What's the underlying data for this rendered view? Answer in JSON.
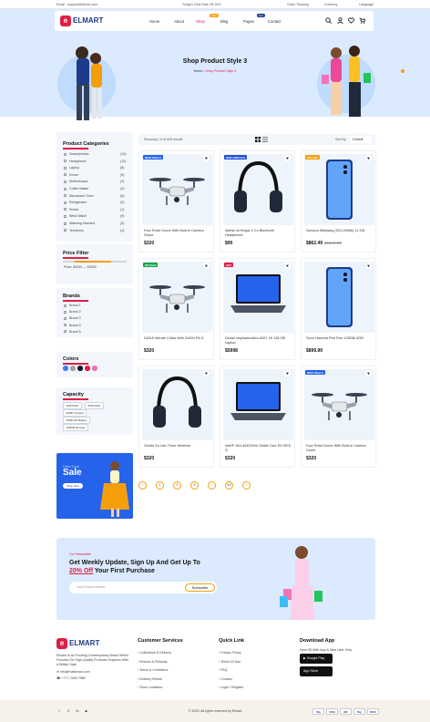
{
  "topbar": {
    "email": "Email : support@elmart.com",
    "deal": "Today's Deal Sale Off 25%",
    "tracking": "Order Tracking",
    "currency": "Currency",
    "language": "Language"
  },
  "brand": {
    "name": "ELMART",
    "letter": "e"
  },
  "nav": {
    "items": [
      "Home",
      "About",
      "Shop",
      "Blog",
      "Pages",
      "Contact"
    ],
    "shop_badge": "Sale",
    "pages_badge": "Hot"
  },
  "hero": {
    "title": "Shop Product Style 3",
    "crumb_home": "Home",
    "crumb_current": "Shop Product Style 3"
  },
  "sidebar": {
    "categories_title": "Product Categories",
    "categories": [
      {
        "name": "Smartphones",
        "count": "(10)"
      },
      {
        "name": "Headphone",
        "count": "(12)"
      },
      {
        "name": "Laptop",
        "count": "(8)"
      },
      {
        "name": "Drone",
        "count": "(5)"
      },
      {
        "name": "Motherboard",
        "count": "(3)"
      },
      {
        "name": "Coffee Maker",
        "count": "(4)"
      },
      {
        "name": "Microwave Oven",
        "count": "(6)"
      },
      {
        "name": "Refrigerator",
        "count": "(2)"
      },
      {
        "name": "Printer",
        "count": "(1)"
      },
      {
        "name": "Wrist Watch",
        "count": "(9)"
      },
      {
        "name": "Washing Machine",
        "count": "(3)"
      },
      {
        "name": "Television",
        "count": "(4)"
      }
    ],
    "price_title": "Price Filter",
    "price_label": "Price:",
    "price_range": "$1000 — $4000",
    "brands_title": "Brands",
    "brands": [
      "Brand 1",
      "Brand 2",
      "Brand 3",
      "Brand 4",
      "Brand 5"
    ],
    "colors_title": "Colors",
    "colors": [
      "#3b82f6",
      "#9ca3af",
      "#111827",
      "#e11d48",
      "#f472b6"
    ],
    "capacity_title": "Capacity",
    "capacity": [
      "4GB RAM",
      "6GB RAM",
      "32MP Camera",
      "4000mAh Battery",
      "128GB Storage",
      "50MP Camera"
    ],
    "promo_small": "Ultra Deal",
    "promo_big": "Sale",
    "promo_button": "Shop Now"
  },
  "toolbar": {
    "results": "Showing 1-9 of 345 results",
    "sort_label": "Sort by:",
    "sort_value": "Default"
  },
  "products": [
    {
      "name": "Four Rotor Drone With Built-In Camera Drone",
      "price": "$320",
      "old": "",
      "badge": "BEST DEALS",
      "badge_color": "#2563eb",
      "icon": "drone-icon"
    },
    {
      "name": "Marish Al Khajar 2 Cu Bluetooth Headphone",
      "price": "$90",
      "old": "",
      "badge": "NEW ARRIVALS",
      "badge_color": "#1d4ed8",
      "icon": "headphone-icon"
    },
    {
      "name": "Samsun Milkyway (S23 25556) 12 GB",
      "price": "$862.49",
      "old": "$1149.99",
      "badge": "20% OFF",
      "badge_color": "#f59e0b",
      "icon": "smartphone-icon"
    },
    {
      "name": "DUDJI Mende 4 Mas With DUDN RX 8",
      "price": "$320",
      "old": "",
      "badge": "ON SALE",
      "badge_color": "#16a34a",
      "icon": "drone-icon"
    },
    {
      "name": "Deulel Inspiradoration 8321 V5 128 GB Laptop",
      "price": "$5998",
      "old": "",
      "badge": "HOT",
      "badge_color": "#e11d48",
      "icon": "laptop-icon"
    },
    {
      "name": "Sonu Havenia Five Five 128GB/ 8GB",
      "price": "$899.99",
      "old": "",
      "badge": "",
      "badge_color": "",
      "icon": "smartphone-icon"
    },
    {
      "name": "Geoffs So Use Three Wireless",
      "price": "$320",
      "old": "",
      "badge": "",
      "badge_color": "",
      "icon": "headphone-icon"
    },
    {
      "name": "Intel® 15A-4442DWU Dellat Core S3 9876 i2",
      "price": "$320",
      "old": "",
      "badge": "",
      "badge_color": "",
      "icon": "laptop-icon"
    },
    {
      "name": "Four Rotor Drone With Built-In Camera Drone",
      "price": "$320",
      "old": "",
      "badge": "BEST DEALS",
      "badge_color": "#2563eb",
      "icon": "drone-icon"
    }
  ],
  "pagination": [
    "‹",
    "1",
    "2",
    "3",
    "...",
    "10",
    "›"
  ],
  "newsletter": {
    "kicker": "Our Newsletter",
    "line1": "Get Weekly Update, Sign Up And Get Up To",
    "highlight": "20% Off",
    "line2": " Your First Purchase",
    "placeholder": "Your Email Address",
    "button": "Subscribe"
  },
  "footer": {
    "about": "Elmark Is An Exciting Contemporary Brand Which Focuses On High-Quality Products Graphics With A British Style",
    "email": "info@mailkman.com",
    "phone": "+777 2345 7885",
    "customer_title": "Customer Services",
    "customer": [
      "Collections & Delivery",
      "Returns & Refunds",
      "Terms & Conditions",
      "Delivery Return",
      "Store Locations"
    ],
    "quick_title": "Quick Link",
    "quick": [
      "Privacy Policy",
      "Terms Of Use",
      "FAQ",
      "Contact",
      "Login / Register"
    ],
    "download_title": "Download App",
    "download_text": "Save $3 With App & New User Only",
    "google": "Google Play",
    "apple": "App Store"
  },
  "bottom": {
    "copyright": "© 2023, All rights reserved by Elmart",
    "social": [
      "f",
      "X",
      "in",
      "▶"
    ],
    "payments": [
      "Pay",
      "VISA",
      "MC",
      "Pay",
      "DISC"
    ]
  }
}
